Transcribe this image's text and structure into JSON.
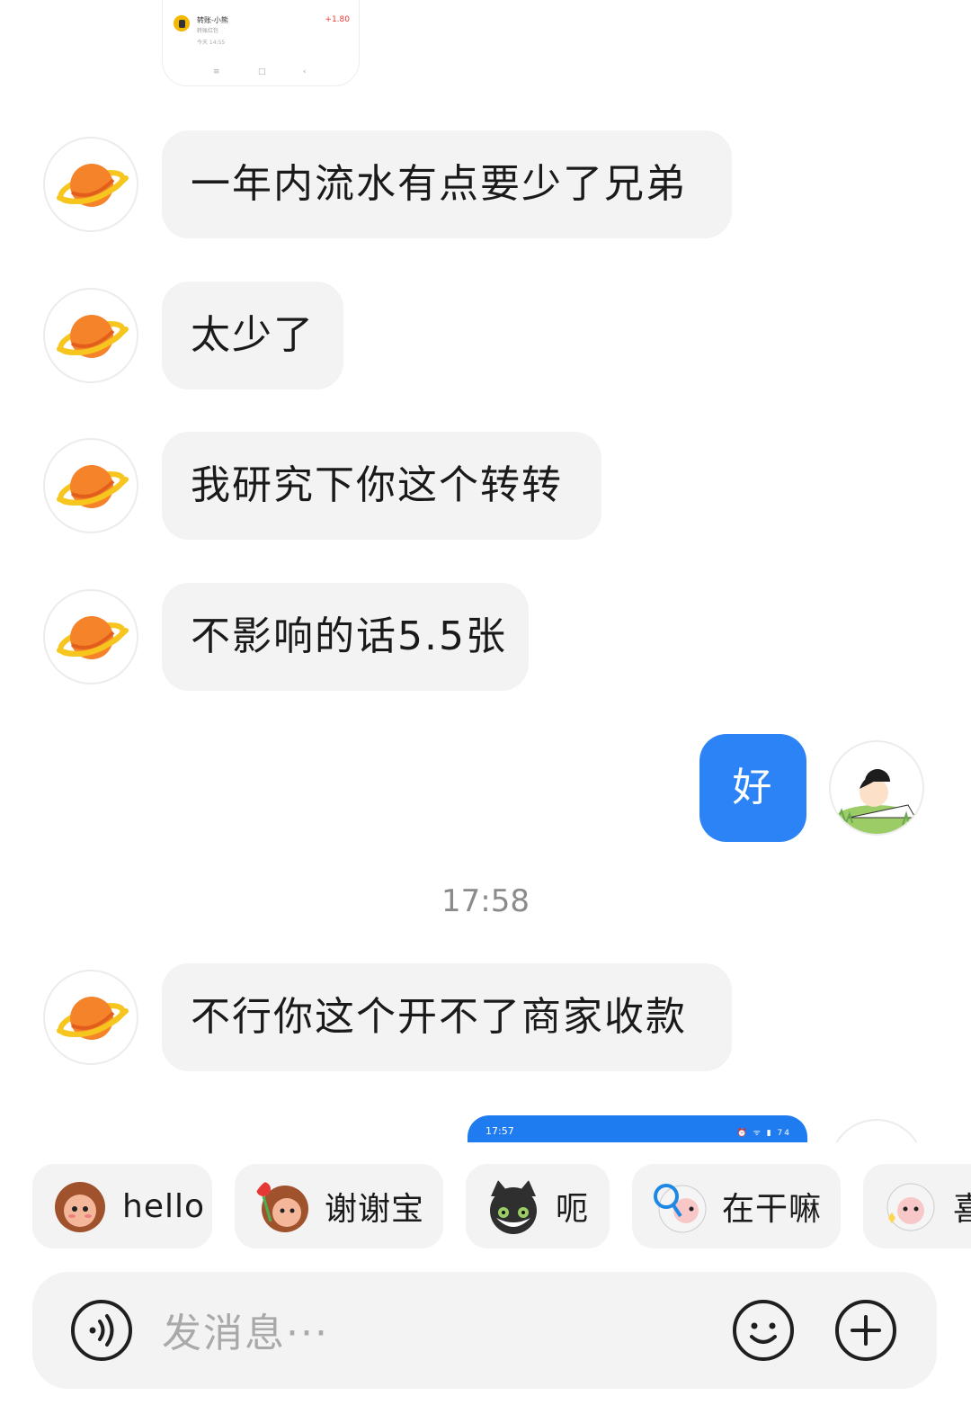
{
  "top_screenshot": {
    "title": "转账-小熊",
    "subtitle": "转账红包",
    "time": "今天 14:55",
    "amount": "+1.80",
    "nav": [
      "≡",
      "□",
      "‹"
    ]
  },
  "messages": [
    {
      "text": "一年内流水有点要少了兄弟"
    },
    {
      "text": "太少了"
    },
    {
      "text": "我研究下你这个转转"
    },
    {
      "text": "不影响的话5.5张"
    },
    {
      "text": "好"
    },
    {
      "text": "不行你这个开不了商家收款"
    }
  ],
  "timestamp": "17:58",
  "outgoing_screenshot": {
    "status_time": "17:57",
    "status_icons": "⏰ ᯤ ▮ 74"
  },
  "quick_replies": [
    {
      "label": "hello",
      "icon": "monkey-sticker-icon"
    },
    {
      "label": "谢谢宝",
      "icon": "monkey-flower-sticker-icon"
    },
    {
      "label": "呃",
      "icon": "cat-sticker-icon"
    },
    {
      "label": "在干嘛",
      "icon": "sheep-magnifier-sticker-icon"
    },
    {
      "label": "喜",
      "icon": "sheep-sticker-icon"
    }
  ],
  "input": {
    "placeholder": "发消息···",
    "voice_icon": "voice-icon",
    "emoji_icon": "emoji-icon",
    "plus_icon": "plus-icon"
  },
  "colors": {
    "accent": "#2b83f6",
    "bubble_gray": "#f3f3f3",
    "planet_orange": "#f5832a",
    "ring_yellow": "#f6c51e"
  }
}
